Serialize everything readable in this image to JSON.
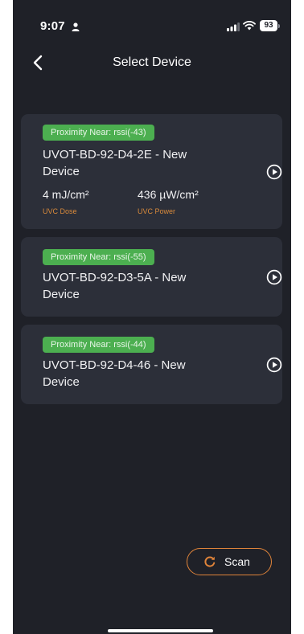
{
  "status_bar": {
    "time": "9:07",
    "battery": "93"
  },
  "header": {
    "title": "Select Device"
  },
  "devices": [
    {
      "proximity": "Proximity Near: rssi(-43)",
      "name": "UVOT-BD-92-D4-2E - New Device",
      "dose_value": "4 mJ/cm²",
      "dose_label": "UVC Dose",
      "power_value": "436 µW/cm²",
      "power_label": "UVC Power"
    },
    {
      "proximity": "Proximity Near: rssi(-55)",
      "name": "UVOT-BD-92-D3-5A - New Device"
    },
    {
      "proximity": "Proximity Near: rssi(-44)",
      "name": "UVOT-BD-92-D4-46 - New Device"
    }
  ],
  "scan_button": {
    "label": "Scan"
  },
  "colors": {
    "background": "#1f2128",
    "card": "#2c2f39",
    "badge_green": "#4caf50",
    "accent_orange": "#e0843a"
  },
  "icons": {
    "back": "chevron-left-icon",
    "connect": "play-circle-icon",
    "scan": "refresh-icon"
  }
}
